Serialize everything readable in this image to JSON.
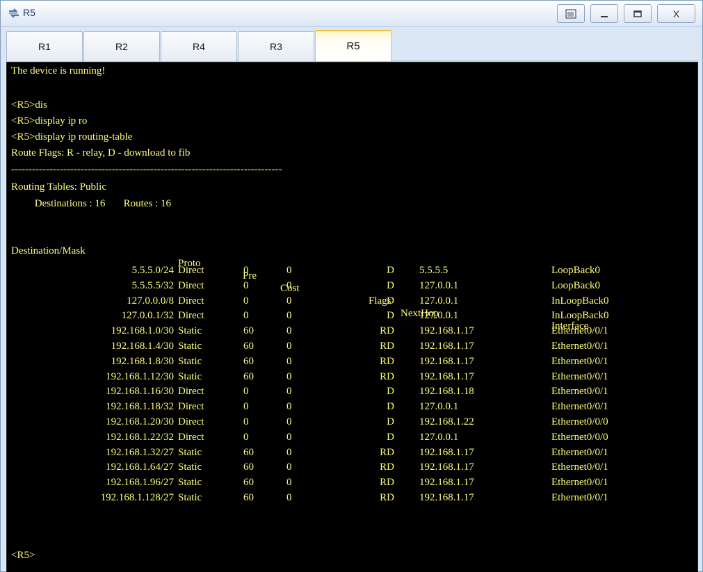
{
  "window": {
    "title": "R5",
    "controls": {
      "restore": "▣",
      "minimize": "—",
      "maximize": "☐",
      "close": "X"
    }
  },
  "tabs": [
    {
      "label": "R1"
    },
    {
      "label": "R2"
    },
    {
      "label": "R4"
    },
    {
      "label": "R3"
    },
    {
      "label": "R5",
      "active": true
    }
  ],
  "terminal": {
    "colors": {
      "background": "#000000",
      "text": "#fffe7a"
    },
    "lines": [
      "The device is running!",
      "",
      "<R5>dis",
      "<R5>display ip ro",
      "<R5>display ip routing-table",
      "Route Flags: R - relay, D - download to fib",
      "------------------------------------------------------------------------------",
      "Routing Tables: Public",
      "         Destinations : 16       Routes : 16"
    ],
    "headers": [
      "Destination/Mask",
      "Proto",
      "Pre",
      "Cost",
      "Flags",
      "NextHop",
      "Interface"
    ],
    "routes": [
      [
        "5.5.5.0/24",
        "Direct",
        "0",
        "0",
        "D",
        "5.5.5.5",
        "LoopBack0"
      ],
      [
        "5.5.5.5/32",
        "Direct",
        "0",
        "0",
        "D",
        "127.0.0.1",
        "LoopBack0"
      ],
      [
        "127.0.0.0/8",
        "Direct",
        "0",
        "0",
        "D",
        "127.0.0.1",
        "InLoopBack0"
      ],
      [
        "127.0.0.1/32",
        "Direct",
        "0",
        "0",
        "D",
        "127.0.0.1",
        "InLoopBack0"
      ],
      [
        "192.168.1.0/30",
        "Static",
        "60",
        "0",
        "RD",
        "192.168.1.17",
        "Ethernet0/0/1"
      ],
      [
        "192.168.1.4/30",
        "Static",
        "60",
        "0",
        "RD",
        "192.168.1.17",
        "Ethernet0/0/1"
      ],
      [
        "192.168.1.8/30",
        "Static",
        "60",
        "0",
        "RD",
        "192.168.1.17",
        "Ethernet0/0/1"
      ],
      [
        "192.168.1.12/30",
        "Static",
        "60",
        "0",
        "RD",
        "192.168.1.17",
        "Ethernet0/0/1"
      ],
      [
        "192.168.1.16/30",
        "Direct",
        "0",
        "0",
        "D",
        "192.168.1.18",
        "Ethernet0/0/1"
      ],
      [
        "192.168.1.18/32",
        "Direct",
        "0",
        "0",
        "D",
        "127.0.0.1",
        "Ethernet0/0/1"
      ],
      [
        "192.168.1.20/30",
        "Direct",
        "0",
        "0",
        "D",
        "192.168.1.22",
        "Ethernet0/0/0"
      ],
      [
        "192.168.1.22/32",
        "Direct",
        "0",
        "0",
        "D",
        "127.0.0.1",
        "Ethernet0/0/0"
      ],
      [
        "192.168.1.32/27",
        "Static",
        "60",
        "0",
        "RD",
        "192.168.1.17",
        "Ethernet0/0/1"
      ],
      [
        "192.168.1.64/27",
        "Static",
        "60",
        "0",
        "RD",
        "192.168.1.17",
        "Ethernet0/0/1"
      ],
      [
        "192.168.1.96/27",
        "Static",
        "60",
        "0",
        "RD",
        "192.168.1.17",
        "Ethernet0/0/1"
      ],
      [
        "192.168.1.128/27",
        "Static",
        "60",
        "0",
        "RD",
        "192.168.1.17",
        "Ethernet0/0/1"
      ]
    ],
    "prompt": "<R5>"
  }
}
